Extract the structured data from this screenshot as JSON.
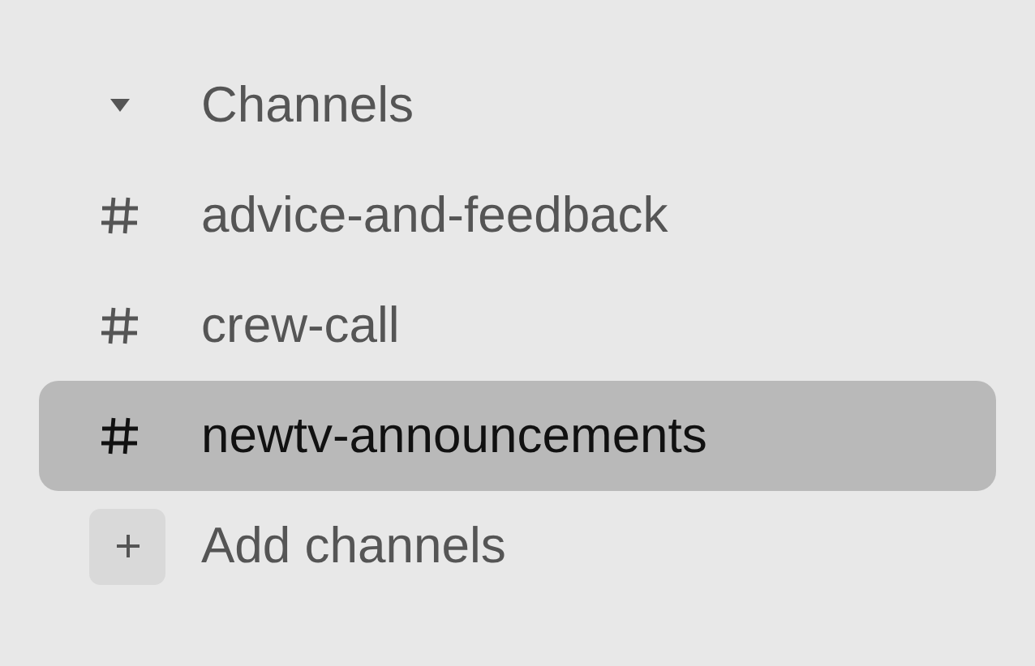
{
  "section": {
    "title": "Channels",
    "expanded": true
  },
  "channels": [
    {
      "name": "advice-and-feedback",
      "selected": false
    },
    {
      "name": "crew-call",
      "selected": false
    },
    {
      "name": "newtv-announcements",
      "selected": true
    }
  ],
  "add_action": {
    "label": "Add channels"
  }
}
